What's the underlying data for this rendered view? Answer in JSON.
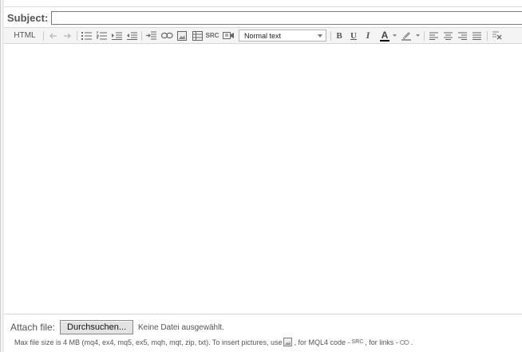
{
  "subject": {
    "label": "Subject:",
    "value": ""
  },
  "toolbar": {
    "html_label": "HTML",
    "src_label": "SRC",
    "format_select": {
      "value": "Normal text"
    },
    "bold_label": "B",
    "underline_label": "U",
    "italic_label": "I",
    "font_color_label": "A",
    "font_color": "#000000",
    "icons": [
      "undo-icon",
      "redo-icon",
      "bullet-list-icon",
      "numbered-list-icon",
      "indent-icon",
      "outdent-icon",
      "horizontal-rule-icon",
      "link-icon",
      "image-icon",
      "table-icon",
      "src-icon",
      "video-icon",
      "font-color-icon",
      "highlight-icon",
      "align-left-icon",
      "align-center-icon",
      "align-right-icon",
      "align-justify-icon",
      "clear-format-icon"
    ]
  },
  "attach": {
    "label": "Attach file:",
    "button_label": "Durchsuchen...",
    "status": "Keine Datei ausgewählt."
  },
  "info": {
    "part1": "Max file size is 4 MB (mq4, ex4, mq5, ex5, mqh, mqt, zip, txt). To insert pictures, use",
    "part2": ", for MQL4 code -",
    "src_glyph": "SRC",
    "part3": ", for links -",
    "part4": "."
  }
}
